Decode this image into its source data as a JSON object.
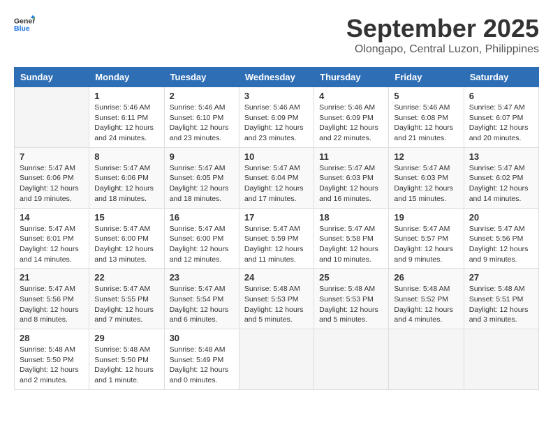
{
  "header": {
    "logo_general": "General",
    "logo_blue": "Blue",
    "month_title": "September 2025",
    "location": "Olongapo, Central Luzon, Philippines"
  },
  "days_of_week": [
    "Sunday",
    "Monday",
    "Tuesday",
    "Wednesday",
    "Thursday",
    "Friday",
    "Saturday"
  ],
  "weeks": [
    [
      {
        "day": "",
        "info": ""
      },
      {
        "day": "1",
        "info": "Sunrise: 5:46 AM\nSunset: 6:11 PM\nDaylight: 12 hours\nand 24 minutes."
      },
      {
        "day": "2",
        "info": "Sunrise: 5:46 AM\nSunset: 6:10 PM\nDaylight: 12 hours\nand 23 minutes."
      },
      {
        "day": "3",
        "info": "Sunrise: 5:46 AM\nSunset: 6:09 PM\nDaylight: 12 hours\nand 23 minutes."
      },
      {
        "day": "4",
        "info": "Sunrise: 5:46 AM\nSunset: 6:09 PM\nDaylight: 12 hours\nand 22 minutes."
      },
      {
        "day": "5",
        "info": "Sunrise: 5:46 AM\nSunset: 6:08 PM\nDaylight: 12 hours\nand 21 minutes."
      },
      {
        "day": "6",
        "info": "Sunrise: 5:47 AM\nSunset: 6:07 PM\nDaylight: 12 hours\nand 20 minutes."
      }
    ],
    [
      {
        "day": "7",
        "info": "Sunrise: 5:47 AM\nSunset: 6:06 PM\nDaylight: 12 hours\nand 19 minutes."
      },
      {
        "day": "8",
        "info": "Sunrise: 5:47 AM\nSunset: 6:06 PM\nDaylight: 12 hours\nand 18 minutes."
      },
      {
        "day": "9",
        "info": "Sunrise: 5:47 AM\nSunset: 6:05 PM\nDaylight: 12 hours\nand 18 minutes."
      },
      {
        "day": "10",
        "info": "Sunrise: 5:47 AM\nSunset: 6:04 PM\nDaylight: 12 hours\nand 17 minutes."
      },
      {
        "day": "11",
        "info": "Sunrise: 5:47 AM\nSunset: 6:03 PM\nDaylight: 12 hours\nand 16 minutes."
      },
      {
        "day": "12",
        "info": "Sunrise: 5:47 AM\nSunset: 6:03 PM\nDaylight: 12 hours\nand 15 minutes."
      },
      {
        "day": "13",
        "info": "Sunrise: 5:47 AM\nSunset: 6:02 PM\nDaylight: 12 hours\nand 14 minutes."
      }
    ],
    [
      {
        "day": "14",
        "info": "Sunrise: 5:47 AM\nSunset: 6:01 PM\nDaylight: 12 hours\nand 14 minutes."
      },
      {
        "day": "15",
        "info": "Sunrise: 5:47 AM\nSunset: 6:00 PM\nDaylight: 12 hours\nand 13 minutes."
      },
      {
        "day": "16",
        "info": "Sunrise: 5:47 AM\nSunset: 6:00 PM\nDaylight: 12 hours\nand 12 minutes."
      },
      {
        "day": "17",
        "info": "Sunrise: 5:47 AM\nSunset: 5:59 PM\nDaylight: 12 hours\nand 11 minutes."
      },
      {
        "day": "18",
        "info": "Sunrise: 5:47 AM\nSunset: 5:58 PM\nDaylight: 12 hours\nand 10 minutes."
      },
      {
        "day": "19",
        "info": "Sunrise: 5:47 AM\nSunset: 5:57 PM\nDaylight: 12 hours\nand 9 minutes."
      },
      {
        "day": "20",
        "info": "Sunrise: 5:47 AM\nSunset: 5:56 PM\nDaylight: 12 hours\nand 9 minutes."
      }
    ],
    [
      {
        "day": "21",
        "info": "Sunrise: 5:47 AM\nSunset: 5:56 PM\nDaylight: 12 hours\nand 8 minutes."
      },
      {
        "day": "22",
        "info": "Sunrise: 5:47 AM\nSunset: 5:55 PM\nDaylight: 12 hours\nand 7 minutes."
      },
      {
        "day": "23",
        "info": "Sunrise: 5:47 AM\nSunset: 5:54 PM\nDaylight: 12 hours\nand 6 minutes."
      },
      {
        "day": "24",
        "info": "Sunrise: 5:48 AM\nSunset: 5:53 PM\nDaylight: 12 hours\nand 5 minutes."
      },
      {
        "day": "25",
        "info": "Sunrise: 5:48 AM\nSunset: 5:53 PM\nDaylight: 12 hours\nand 5 minutes."
      },
      {
        "day": "26",
        "info": "Sunrise: 5:48 AM\nSunset: 5:52 PM\nDaylight: 12 hours\nand 4 minutes."
      },
      {
        "day": "27",
        "info": "Sunrise: 5:48 AM\nSunset: 5:51 PM\nDaylight: 12 hours\nand 3 minutes."
      }
    ],
    [
      {
        "day": "28",
        "info": "Sunrise: 5:48 AM\nSunset: 5:50 PM\nDaylight: 12 hours\nand 2 minutes."
      },
      {
        "day": "29",
        "info": "Sunrise: 5:48 AM\nSunset: 5:50 PM\nDaylight: 12 hours\nand 1 minute."
      },
      {
        "day": "30",
        "info": "Sunrise: 5:48 AM\nSunset: 5:49 PM\nDaylight: 12 hours\nand 0 minutes."
      },
      {
        "day": "",
        "info": ""
      },
      {
        "day": "",
        "info": ""
      },
      {
        "day": "",
        "info": ""
      },
      {
        "day": "",
        "info": ""
      }
    ]
  ]
}
